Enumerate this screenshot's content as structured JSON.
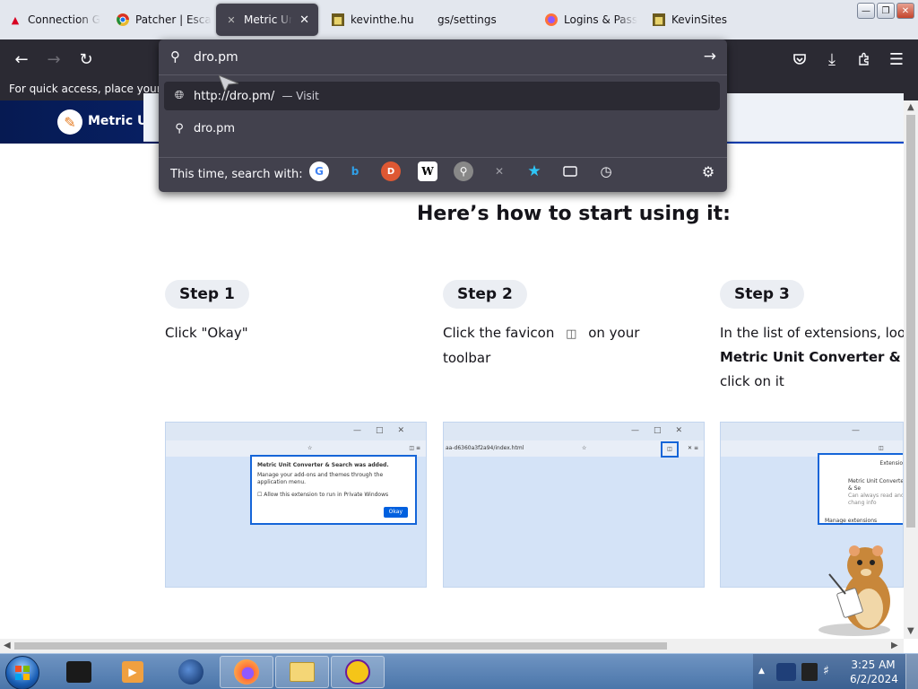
{
  "tabs": [
    {
      "title": "Connection G",
      "icon": "pdf-red-icon"
    },
    {
      "title": "Patcher | Esca",
      "icon": "chrome-icon"
    },
    {
      "title": "Metric Unit",
      "icon": "extension-icon",
      "active": true
    },
    {
      "title": "kevinthe.hu",
      "icon": "site-icon"
    },
    {
      "title": "gs/settings",
      "icon": "settings-icon"
    },
    {
      "title": "Logins & Pass",
      "icon": "firefox-icon"
    },
    {
      "title": "KevinSites",
      "icon": "site-icon"
    }
  ],
  "urlbar": {
    "query": "dro.pm",
    "results": [
      {
        "text": "http://dro.pm/",
        "action": "— Visit",
        "icon": "globe-icon"
      },
      {
        "text": "dro.pm",
        "action": "",
        "icon": "search-icon"
      }
    ],
    "search_with_label": "This time, search with:",
    "engines": [
      "google",
      "bing",
      "duckduckgo",
      "wikipedia",
      "search",
      "close",
      "bookmarks",
      "tabs",
      "history"
    ]
  },
  "bookmarks_bar": {
    "hint": "For quick access, place your boo"
  },
  "site": {
    "name": "Metric Unit C",
    "heading": "Here’s how to start using it:",
    "steps": [
      {
        "badge": "Step 1",
        "text": "Click \"Okay\""
      },
      {
        "badge": "Step 2",
        "text_a": "Click the favicon",
        "text_b": "on your",
        "text_c": "toolbar"
      },
      {
        "badge": "Step 3",
        "text_a": "In the list of extensions, look",
        "bold": "Metric Unit Converter & Sear",
        "text_c": "click on it"
      }
    ],
    "shot1": {
      "title": "Metric Unit Converter & Search was added.",
      "body": "Manage your add-ons and themes through the application menu.",
      "checkbox": "Allow this extension to run in Private Windows",
      "button": "Okay"
    },
    "shot2": {
      "address": "aa-d6360a3f2a94/index.html"
    },
    "shot3": {
      "title": "Extensions",
      "item": "Metric Unit Converter & Se",
      "sub": "Can always read and chang info",
      "manage": "Manage extensions"
    }
  },
  "taskbar": {
    "time": "3:25 AM",
    "date": "6/2/2024"
  }
}
